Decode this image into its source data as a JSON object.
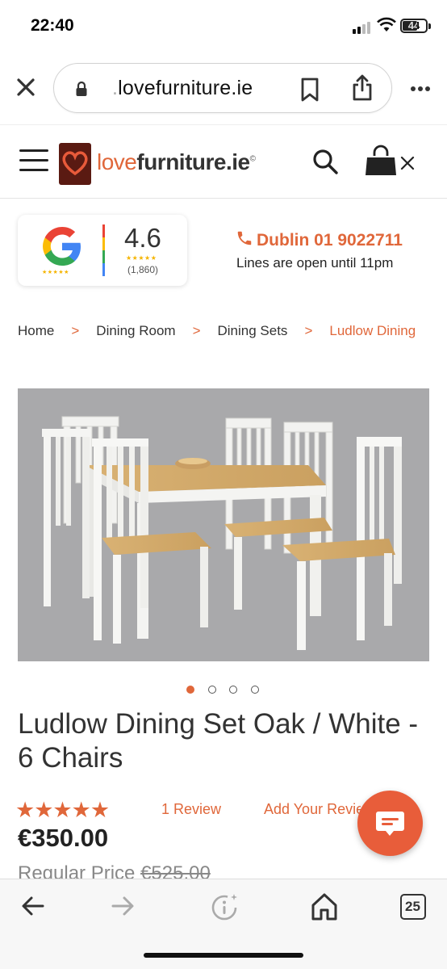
{
  "status_bar": {
    "time": "22:40",
    "battery": "44",
    "icons": [
      "signal-icon",
      "wifi-icon",
      "battery-icon"
    ]
  },
  "browser": {
    "url_prefix": ".",
    "url_domain": "lovefurniture.ie",
    "icons": [
      "close-icon",
      "lock-icon",
      "bookmark-icon",
      "share-icon",
      "more-icon"
    ]
  },
  "site": {
    "logo_love": "love",
    "logo_furniture": "furniture",
    "logo_ie": ".ie",
    "logo_reg": "©",
    "icons": [
      "menu-icon",
      "search-icon",
      "shopping-bag-icon",
      "close-icon"
    ]
  },
  "google_rating": {
    "score": "4.6",
    "count": "(1,860)",
    "stars": "★★★★★"
  },
  "contact": {
    "phone": "Dublin 01 9022711",
    "hours": "Lines are open until 11pm"
  },
  "breadcrumb": [
    {
      "label": "Home"
    },
    {
      "label": "Dining Room"
    },
    {
      "label": "Dining Sets"
    },
    {
      "label": "Ludlow Dining"
    }
  ],
  "breadcrumb_sep": ">",
  "carousel": {
    "count": 4,
    "active_index": 0
  },
  "product": {
    "title": "Ludlow Dining Set Oak / White - 6 Chairs",
    "rating_stars": "★★★★★",
    "review_link": "1 Review",
    "add_review": "Add Your Review",
    "price": "€350.00",
    "regular_price_label": "Regular Price",
    "regular_price": "€525.00"
  },
  "toolbar": {
    "tabs_count": "25",
    "icons": [
      "back-arrow-icon",
      "forward-arrow-icon",
      "info-icon",
      "home-icon",
      "tabs-icon"
    ]
  },
  "colors": {
    "accent": "#e0673a",
    "chat": "#e85d3a",
    "logo_bg": "#5a1a12"
  }
}
